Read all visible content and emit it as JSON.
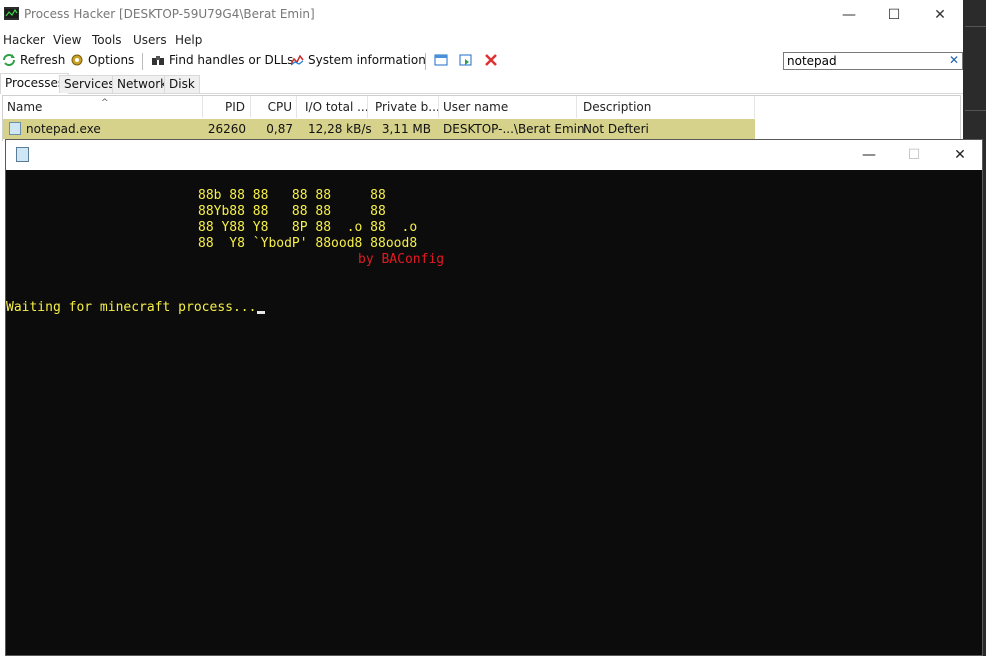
{
  "process_hacker": {
    "title": "Process Hacker [DESKTOP-59U79G4\\Berat Emin]",
    "window_controls": {
      "minimize": "—",
      "maximize": "☐",
      "close": "✕"
    },
    "menu": [
      "Hacker",
      "View",
      "Tools",
      "Users",
      "Help"
    ],
    "toolbar": {
      "refresh": "Refresh",
      "options": "Options",
      "find_handles": "Find handles or DLLs",
      "system_information": "System information"
    },
    "search": {
      "value": "notepad",
      "clear": "✕"
    },
    "tabs": [
      "Processes",
      "Services",
      "Network",
      "Disk"
    ],
    "columns": [
      "Name",
      "PID",
      "CPU",
      "I/O total ...",
      "Private b...",
      "User name",
      "Description"
    ],
    "rows": [
      {
        "name": "notepad.exe",
        "pid": "26260",
        "cpu": "0,87",
        "io_total": "12,28 kB/s",
        "private_bytes": "3,11 MB",
        "user_name": "DESKTOP-...\\Berat Emin",
        "description": "Not Defteri"
      }
    ]
  },
  "console": {
    "controls": {
      "minimize": "—",
      "maximize": "☐",
      "close": "✕"
    },
    "ascii_art": [
      "88b 88 88   88 88     88",
      "88Yb88 88   88 88     88",
      "88 Y88 Y8   8P 88  .o 88  .o",
      "88  Y8 `YbodP' 88ood8 88ood8"
    ],
    "credit": "by BAConfig",
    "status": "Waiting for minecraft process...",
    "colors": {
      "text": "#f5ef47",
      "credit": "#e01b24",
      "background": "#0c0c0c"
    }
  }
}
